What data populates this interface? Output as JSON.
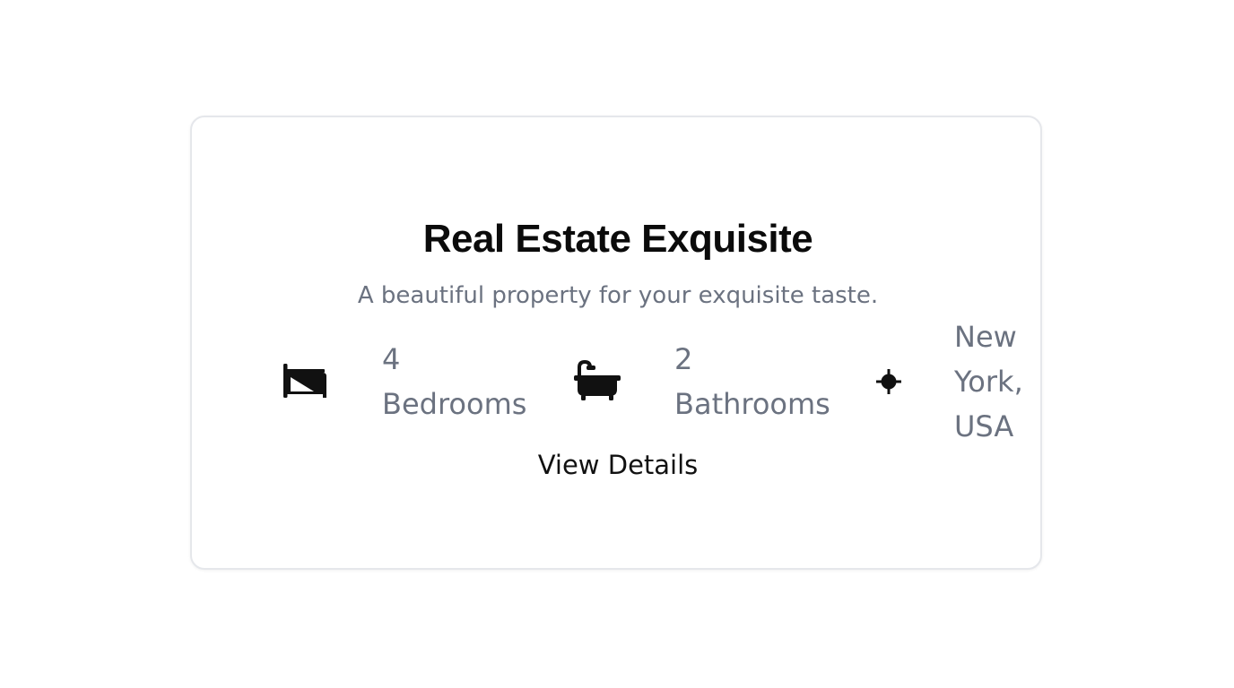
{
  "card": {
    "title": "Real Estate Exquisite",
    "subtitle": "A beautiful property for your exquisite taste.",
    "features": [
      {
        "icon": "bed-icon",
        "line1": "4",
        "line2": "Bedrooms"
      },
      {
        "icon": "bathtub-icon",
        "line1": "2",
        "line2": "Bathrooms"
      },
      {
        "icon": "location-crosshair-icon",
        "line1": "New",
        "line2": "York,",
        "line3": "USA"
      }
    ],
    "button_label": "View Details"
  },
  "colors": {
    "title": "#0b0b0b",
    "muted_text": "#6b7280",
    "border": "#e5e7eb",
    "icon": "#111111"
  }
}
